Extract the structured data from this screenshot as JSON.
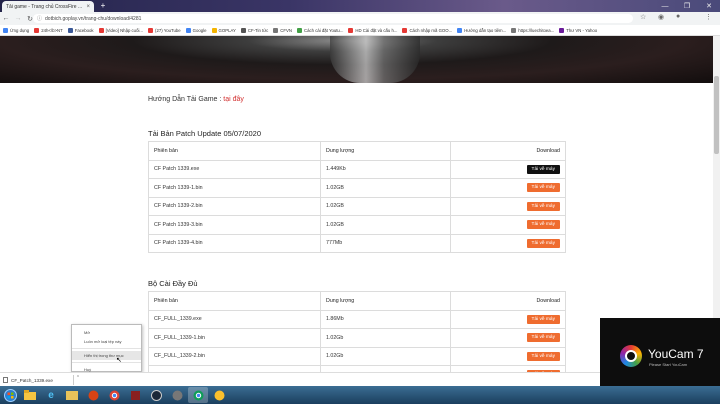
{
  "browser": {
    "tabs": [
      {
        "title": "Tải game - Trang chủ CrossFire ...",
        "close": "×"
      },
      {
        "title": "",
        "close": "+"
      }
    ],
    "window_controls": [
      "—",
      "❐",
      "✕"
    ],
    "nav": {
      "back": "←",
      "forward": "→",
      "reload": "↻"
    },
    "url": "dotbich.goplay.vn/trang-chu/download/4281",
    "bookmarks": [
      {
        "label": "Ứng dụng",
        "color": "#4285f4"
      },
      {
        "label": "24h</b>NT",
        "color": "#e53935"
      },
      {
        "label": "Facebook",
        "color": "#3b5998"
      },
      {
        "label": "[Video] Nhập cuối...",
        "color": "#e53935"
      },
      {
        "label": "(27) YouTube",
        "color": "#e53935"
      },
      {
        "label": "Google",
        "color": "#4285f4"
      },
      {
        "label": "GOPLAY",
        "color": "#f4b400"
      },
      {
        "label": "CF-Tin tức",
        "color": "#555"
      },
      {
        "label": "CFVN",
        "color": "#777"
      },
      {
        "label": "Cách cài đặt Youtu...",
        "color": "#43a047"
      },
      {
        "label": "HD Cài đặt và cấu h...",
        "color": "#e53935"
      },
      {
        "label": "Cách nhập mã GOO...",
        "color": "#e53935"
      },
      {
        "label": "Hướng dẫn tạo tiêm...",
        "color": "#4285f4"
      },
      {
        "label": "https://luechitoea...",
        "color": "#777"
      },
      {
        "label": "Thư VN - Yahoo",
        "color": "#6a1b9a"
      }
    ]
  },
  "page": {
    "guide_text": "Hướng Dẫn Tải Game : ",
    "guide_link": "tại đây",
    "sections": [
      {
        "title": "Tải Bản Patch Update 05/07/2020",
        "headers": [
          "Phiên bản",
          "Dung lượng",
          "Download"
        ],
        "rows": [
          {
            "name": "CF Patch 1339.exe",
            "size": "1.449Kb",
            "button": "Tải về máy"
          },
          {
            "name": "CF Patch 1339-1.bin",
            "size": "1.02GB",
            "button": "Tải về máy"
          },
          {
            "name": "CF Patch 1339-2.bin",
            "size": "1.02GB",
            "button": "Tải về máy"
          },
          {
            "name": "CF Patch 1339-3.bin",
            "size": "1.02GB",
            "button": "Tải về máy"
          },
          {
            "name": "CF Patch 1339-4.bin",
            "size": "777Mb",
            "button": "Tải về máy"
          }
        ]
      },
      {
        "title": "Bộ Cài Đầy Đủ",
        "headers": [
          "Phiên bản",
          "Dung lượng",
          "Download"
        ],
        "rows": [
          {
            "name": "CF_FULL_1339.exe",
            "size": "1.86Mb",
            "button": "Tải về máy"
          },
          {
            "name": "CF_FULL_1339-1.bin",
            "size": "1.02Gb",
            "button": "Tải về máy"
          },
          {
            "name": "CF_FULL_1339-2.bin",
            "size": "1.02Gb",
            "button": "Tải về máy"
          },
          {
            "name": "",
            "size": "",
            "button": "Tải về máy"
          }
        ]
      }
    ]
  },
  "context_menu": {
    "items": [
      "Mở",
      "Luôn mở loại tệp này",
      "Hiển thị trong thư mục",
      "Huỷ"
    ]
  },
  "download_shelf": {
    "file": "CF_Patch_1339.exe",
    "chevron": "⌃"
  },
  "youcam": {
    "name": "YouCam 7",
    "subtitle": "Please Start YouCam"
  },
  "taskbar": {
    "icons": [
      "start",
      "explorer-folder",
      "internet-explorer",
      "file-manager",
      "media-player",
      "chrome",
      "game",
      "steam",
      "app",
      "chrome-active",
      "app2"
    ]
  }
}
